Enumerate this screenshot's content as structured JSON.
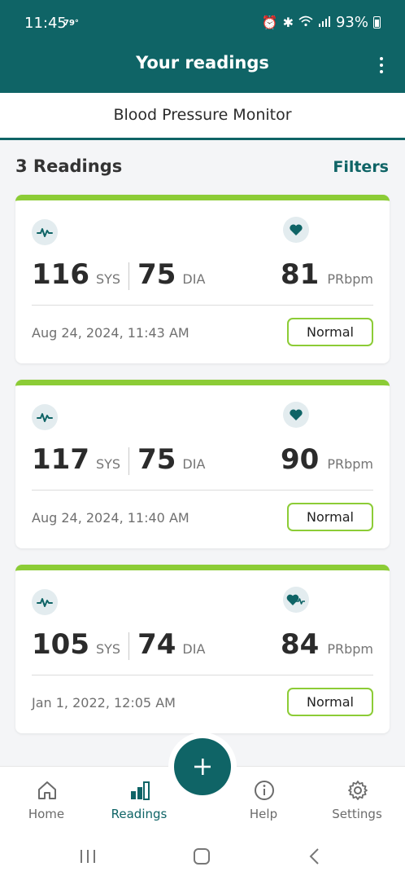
{
  "status_bar": {
    "time": "11:45",
    "temp": "79°",
    "battery": "93%"
  },
  "app_bar": {
    "title": "Your readings"
  },
  "tab": {
    "label": "Blood Pressure Monitor"
  },
  "list_header": {
    "count_label": "3 Readings",
    "filters_label": "Filters"
  },
  "readings": [
    {
      "sys": "116",
      "sys_unit": "SYS",
      "dia": "75",
      "dia_unit": "DIA",
      "pulse": "81",
      "pulse_unit": "PRbpm",
      "date": "Aug 24, 2024, 11:43 AM",
      "status": "Normal",
      "pulse_icon": "heart-icon"
    },
    {
      "sys": "117",
      "sys_unit": "SYS",
      "dia": "75",
      "dia_unit": "DIA",
      "pulse": "90",
      "pulse_unit": "PRbpm",
      "date": "Aug 24, 2024, 11:40 AM",
      "status": "Normal",
      "pulse_icon": "heart-icon"
    },
    {
      "sys": "105",
      "sys_unit": "SYS",
      "dia": "74",
      "dia_unit": "DIA",
      "pulse": "84",
      "pulse_unit": "PRbpm",
      "date": "Jan 1, 2022, 12:05 AM",
      "status": "Normal",
      "pulse_icon": "irregular-heartbeat-icon"
    }
  ],
  "bottom_nav": {
    "items": [
      {
        "label": "Home",
        "icon": "home-icon"
      },
      {
        "label": "Readings",
        "icon": "readings-icon",
        "active": true
      },
      {
        "label": "Help",
        "icon": "info-icon"
      },
      {
        "label": "Settings",
        "icon": "gear-icon"
      }
    ],
    "fab_icon": "plus-icon"
  },
  "colors": {
    "primary": "#0f6466",
    "normal_accent": "#8ccc36",
    "background": "#f4f5f7"
  }
}
